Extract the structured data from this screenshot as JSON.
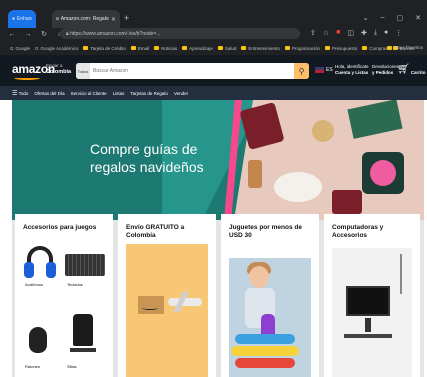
{
  "browser": {
    "tabs": [
      {
        "label": "Enhance"
      },
      {
        "label": "Amazon.com: Regalos navideños"
      }
    ],
    "new_tab": "+",
    "window_controls": [
      "⌄",
      "–",
      "▢",
      "✕"
    ],
    "url": "https://www.amazon.com/-/es/b?node=...",
    "bookmarks": [
      "Google",
      "Google Académico",
      "Tarjeta de Crédito",
      "Email",
      "Noticias",
      "Aprendizaje",
      "Salud",
      "Entretenimiento",
      "Programación",
      "Presupuesto",
      "Compras",
      "Bancos"
    ],
    "bookmarks_right": "Otros favoritos"
  },
  "amazon": {
    "logo": "amazon",
    "deliver_line1": "Enviar a",
    "deliver_line2": "Colombia",
    "search_category": "Todos",
    "search_placeholder": "Buscar Amazon",
    "language": "ES",
    "account_line1": "Hola, identifícate",
    "account_line2": "Cuenta y Listas",
    "orders_line1": "Devoluciones",
    "orders_line2": "y Pedidos",
    "cart_label": "Carrito",
    "subnav": {
      "all": "Todo",
      "items": [
        "Ofertas del Día",
        "Servicio al Cliente",
        "Listas",
        "Tarjetas de Regalo",
        "Vender"
      ]
    },
    "hero_title_line1": "Compre guías de",
    "hero_title_line2": "regalos navideños",
    "cards": [
      {
        "title": "Accesorios para juegos",
        "items": [
          "Audífonos",
          "Teclados",
          "Ratones",
          "Sillas"
        ]
      },
      {
        "title": "Envío GRATUITO a Colombia"
      },
      {
        "title": "Juguetes por menos de USD 30"
      },
      {
        "title": "Computadoras y Accesorios"
      }
    ]
  }
}
